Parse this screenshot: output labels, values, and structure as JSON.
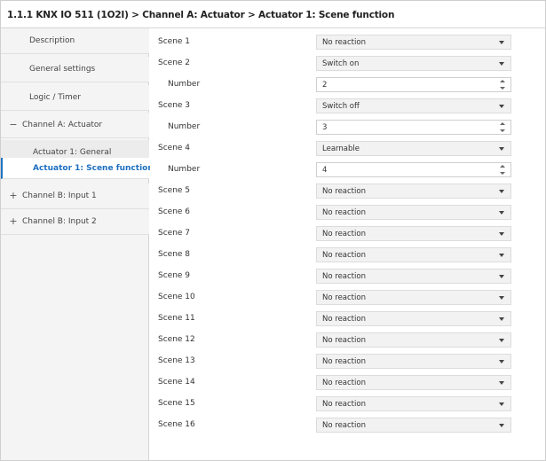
{
  "title": "1.1.1 KNX IO 511 (1O2I) > Channel A: Actuator > Actuator 1: Scene function",
  "sidebar": {
    "items": [
      {
        "label": "Description",
        "sign": ""
      },
      {
        "label": "General settings",
        "sign": ""
      },
      {
        "label": "Logic / Timer",
        "sign": ""
      },
      {
        "label": "Channel A: Actuator",
        "sign": "−"
      },
      {
        "label": "Actuator 1: General",
        "sign": ""
      },
      {
        "label": "Actuator 1: Scene function",
        "sign": ""
      },
      {
        "label": "Channel B: Input 1",
        "sign": "+"
      },
      {
        "label": "Channel B: Input 2",
        "sign": "+"
      }
    ]
  },
  "params": {
    "rows": [
      {
        "label": "Scene 1",
        "value": "No reaction"
      },
      {
        "label": "Scene 2",
        "value": "Switch on"
      },
      {
        "label": "Number",
        "value": "2"
      },
      {
        "label": "Scene 3",
        "value": "Switch off"
      },
      {
        "label": "Number",
        "value": "3"
      },
      {
        "label": "Scene 4",
        "value": "Learnable"
      },
      {
        "label": "Number",
        "value": "4"
      },
      {
        "label": "Scene 5",
        "value": "No reaction"
      },
      {
        "label": "Scene 6",
        "value": "No reaction"
      },
      {
        "label": "Scene 7",
        "value": "No reaction"
      },
      {
        "label": "Scene 8",
        "value": "No reaction"
      },
      {
        "label": "Scene 9",
        "value": "No reaction"
      },
      {
        "label": "Scene 10",
        "value": "No reaction"
      },
      {
        "label": "Scene 11",
        "value": "No reaction"
      },
      {
        "label": "Scene 12",
        "value": "No reaction"
      },
      {
        "label": "Scene 13",
        "value": "No reaction"
      },
      {
        "label": "Scene 14",
        "value": "No reaction"
      },
      {
        "label": "Scene 15",
        "value": "No reaction"
      },
      {
        "label": "Scene 16",
        "value": "No reaction"
      }
    ]
  },
  "colors": {
    "accent": "#1d6fc1",
    "sidebar_bg": "#f4f4f4",
    "select_bg": "#f2f2f2"
  }
}
